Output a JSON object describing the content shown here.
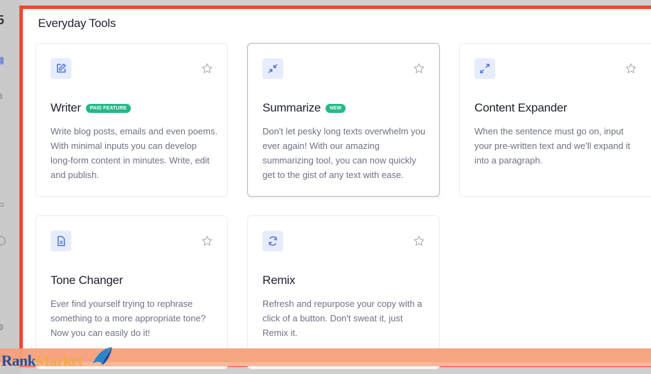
{
  "section": {
    "title": "Everyday Tools"
  },
  "tools": [
    {
      "title": "Writer",
      "badge": "PAID FEATURE",
      "description": "Write blog posts, emails and even poems. With minimal inputs you can develop long-form content in minutes. Write, edit and publish.",
      "icon": "edit-icon"
    },
    {
      "title": "Summarize",
      "badge": "NEW",
      "description": "Don't let pesky long texts overwhelm you ever again! With our amazing summarizing tool, you can now quickly get to the gist of any text with ease.",
      "icon": "collapse-icon"
    },
    {
      "title": "Content Expander",
      "badge": "",
      "description": "When the sentence must go on, input your pre-written text and we'll expand it into a paragraph.",
      "icon": "expand-icon"
    },
    {
      "title": "Tone Changer",
      "badge": "",
      "description": "Ever find yourself trying to rephrase something to a more appropriate tone? Now you can easily do it!",
      "icon": "document-icon"
    },
    {
      "title": "Remix",
      "badge": "",
      "description": "Refresh and repurpose your copy with a click of a button. Don't sweat it, just Remix it.",
      "icon": "refresh-icon"
    }
  ],
  "watermark": {
    "part1": "Rank",
    "part2": "Market"
  },
  "colors": {
    "accent": "#4d6fe0",
    "badge": "#27b788",
    "highlight_border": "#f0462f"
  }
}
